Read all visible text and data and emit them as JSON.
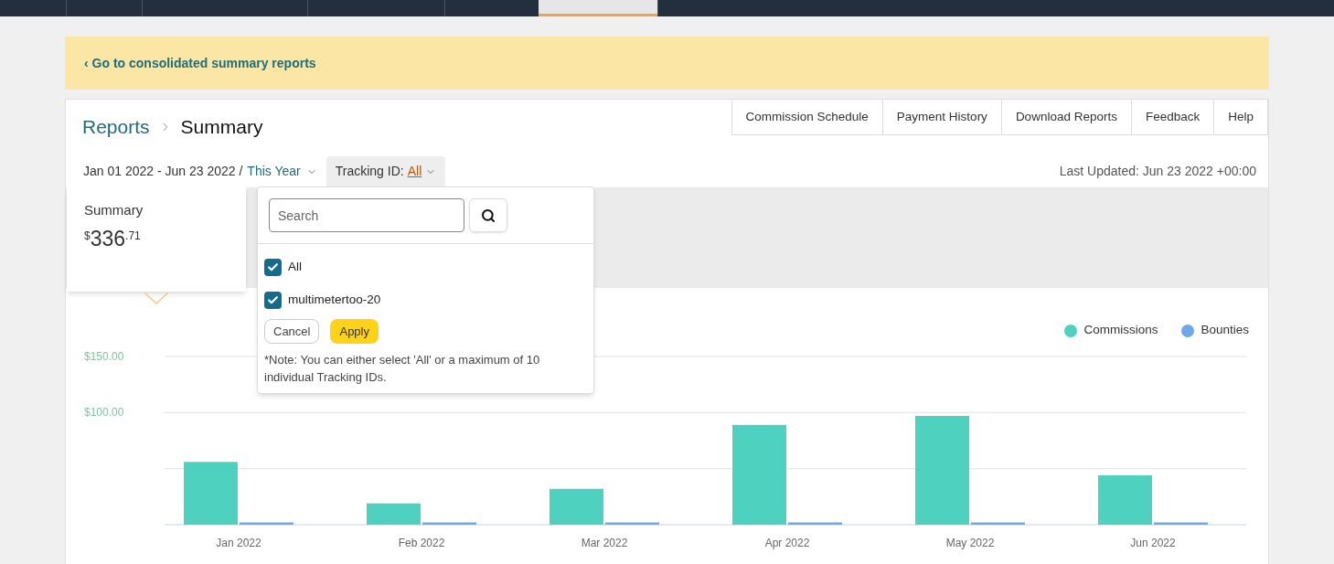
{
  "nav": {
    "tabs": [
      {
        "selected": false
      },
      {
        "selected": false
      },
      {
        "selected": false
      },
      {
        "selected": false
      },
      {
        "selected": true
      },
      {
        "selected": false
      }
    ]
  },
  "banner": {
    "link": "‹ Go to consolidated summary reports"
  },
  "breadcrumb": [
    "Reports",
    "Summary"
  ],
  "header_tabs": [
    "Commission Schedule",
    "Payment History",
    "Download Reports",
    "Feedback",
    "Help"
  ],
  "filter": {
    "date_range": "Jan 01 2022 - Jun 23 2022 /",
    "period": "This Year",
    "tracking_label": "Tracking ID:",
    "tracking_value": "All",
    "last_updated": "Last Updated: Jun 23 2022 +00:00"
  },
  "summary_card": {
    "title": "Summary",
    "currency": "$",
    "whole": "336",
    "cents": ".71"
  },
  "dropdown": {
    "search": {
      "placeholder": "Search"
    },
    "options": [
      {
        "label": "All",
        "checked": true
      },
      {
        "label": "multimetertoo-20",
        "checked": true
      }
    ],
    "buttons": [
      {
        "label": "Cancel",
        "kind": "secondary"
      },
      {
        "label": "Apply",
        "kind": "primary"
      }
    ],
    "note": "*Note: You can either select 'All' or a maximum of 10 individual Tracking IDs."
  },
  "chart": {
    "chart_data": {
      "type": "bar",
      "categories": [
        "Jan 2022",
        "Feb 2022",
        "Mar 2022",
        "Apr 2022",
        "May 2022",
        "Jun 2022"
      ],
      "series": [
        {
          "name": "Commissions",
          "color": "#4fd1c0",
          "values": [
            56,
            19,
            32,
            89,
            97,
            44
          ]
        },
        {
          "name": "Bounties",
          "color": "#6fa8e8",
          "values": [
            2,
            2,
            2,
            2,
            2,
            2
          ]
        }
      ],
      "ylim": [
        0,
        150
      ],
      "yticks": [
        {
          "value": 100,
          "label": "$100.00"
        },
        {
          "value": 150,
          "label": "$150.00"
        }
      ]
    }
  }
}
